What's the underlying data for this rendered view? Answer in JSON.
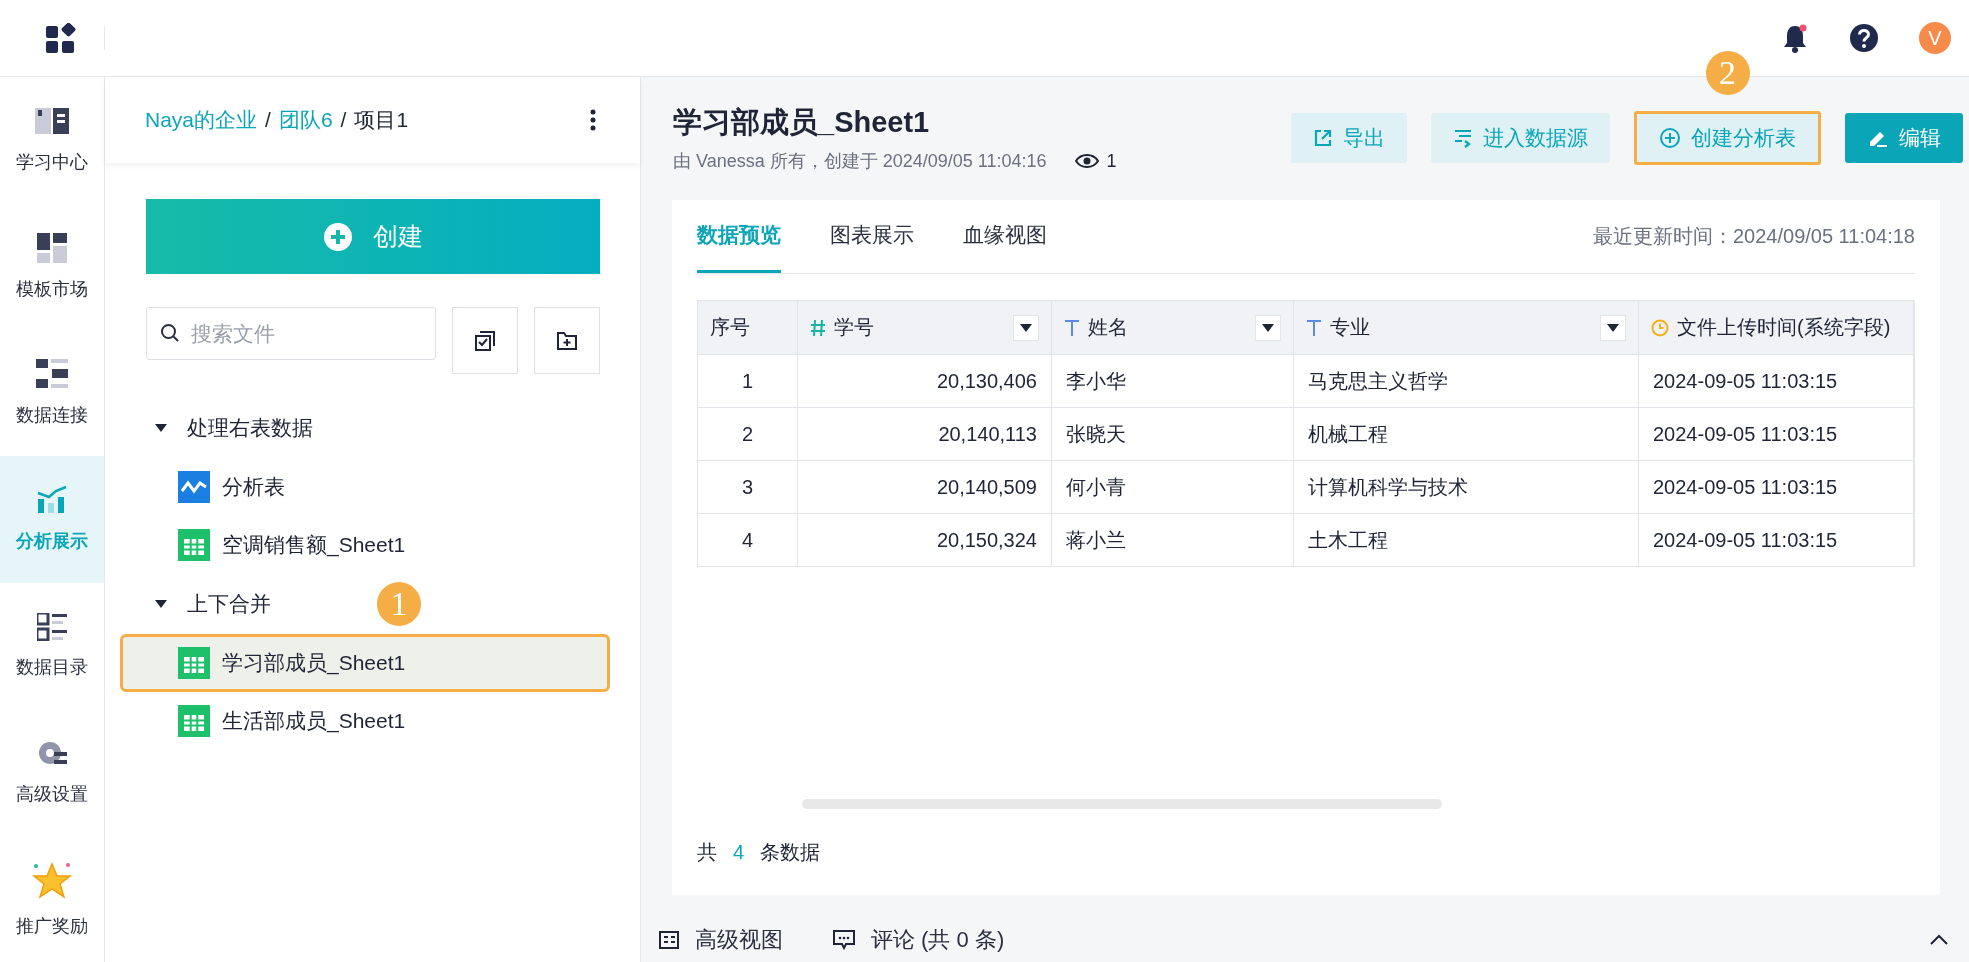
{
  "top_bar": {
    "avatar": "V",
    "notification_dot": true
  },
  "nav": [
    {
      "label": "学习中心",
      "kind": "book",
      "selected": false
    },
    {
      "label": "模板市场",
      "kind": "template",
      "selected": false
    },
    {
      "label": "数据连接",
      "kind": "connect",
      "selected": false
    },
    {
      "label": "分析展示",
      "kind": "chart",
      "selected": true
    },
    {
      "label": "数据目录",
      "kind": "catalog",
      "selected": false
    },
    {
      "label": "高级设置",
      "kind": "gear",
      "selected": false
    },
    {
      "label": "推广奖励",
      "kind": "star",
      "selected": false
    }
  ],
  "sidebar": {
    "breadcrumb": [
      {
        "label": "Naya的企业",
        "kind": "link"
      },
      {
        "label": "/",
        "kind": "separator"
      },
      {
        "label": "团队6",
        "kind": "link"
      },
      {
        "label": "/",
        "kind": "separator"
      },
      {
        "label": "项目1",
        "kind": "current"
      }
    ],
    "create_button": "创建",
    "search": {
      "placeholder": "搜索文件"
    },
    "tree": [
      {
        "label": "处理右表数据",
        "expanded": true,
        "children": [
          {
            "label": "分析表",
            "kind": "analysis",
            "selected": false,
            "highlighted": false
          },
          {
            "label": "空调销售额_Sheet1",
            "kind": "sheet",
            "selected": false,
            "highlighted": false
          }
        ]
      },
      {
        "label": "上下合并",
        "expanded": true,
        "step": "1",
        "children": [
          {
            "label": "学习部成员_Sheet1",
            "kind": "sheet",
            "selected": true,
            "highlighted": true
          },
          {
            "label": "生活部成员_Sheet1",
            "kind": "sheet",
            "selected": false,
            "highlighted": false
          }
        ]
      }
    ]
  },
  "main": {
    "title": "学习部成员_Sheet1",
    "subtitle": "由 Vanessa 所有，创建于 2024/09/05 11:04:16",
    "views": "1",
    "buttons": [
      {
        "label": "导出",
        "kind": "export",
        "primary": false,
        "highlighted": false
      },
      {
        "label": "进入数据源",
        "kind": "source",
        "primary": false,
        "highlighted": false
      },
      {
        "label": "创建分析表",
        "kind": "create",
        "primary": false,
        "highlighted": true,
        "step": "2"
      },
      {
        "label": "编辑",
        "kind": "edit",
        "primary": true,
        "highlighted": false
      }
    ],
    "tabs": [
      {
        "label": "数据预览",
        "selected": true
      },
      {
        "label": "图表展示",
        "selected": false
      },
      {
        "label": "血缘视图",
        "selected": false
      }
    ],
    "updated": "最近更新时间：2024/09/05 11:04:18",
    "table": {
      "columns": [
        {
          "label": "序号",
          "kind": "index",
          "dropdown": false
        },
        {
          "label": "学号",
          "kind": "number",
          "dropdown": true
        },
        {
          "label": "姓名",
          "kind": "text",
          "dropdown": true
        },
        {
          "label": "专业",
          "kind": "text",
          "dropdown": true
        },
        {
          "label": "文件上传时间(系统字段)",
          "kind": "time",
          "dropdown": false
        }
      ],
      "rows": [
        [
          "1",
          "20,130,406",
          "李小华",
          "马克思主义哲学",
          "2024-09-05 11:03:15"
        ],
        [
          "2",
          "20,140,113",
          "张晓天",
          "机械工程",
          "2024-09-05 11:03:15"
        ],
        [
          "3",
          "20,140,509",
          "何小青",
          "计算机科学与技术",
          "2024-09-05 11:03:15"
        ],
        [
          "4",
          "20,150,324",
          "蒋小兰",
          "土木工程",
          "2024-09-05 11:03:15"
        ]
      ]
    },
    "footer": {
      "prefix": "共",
      "count": "4",
      "suffix": "条数据"
    },
    "bottom_tabs": [
      {
        "label": "高级视图",
        "kind": "view"
      },
      {
        "label": "评论 (共 0 条)",
        "kind": "comment"
      }
    ]
  }
}
